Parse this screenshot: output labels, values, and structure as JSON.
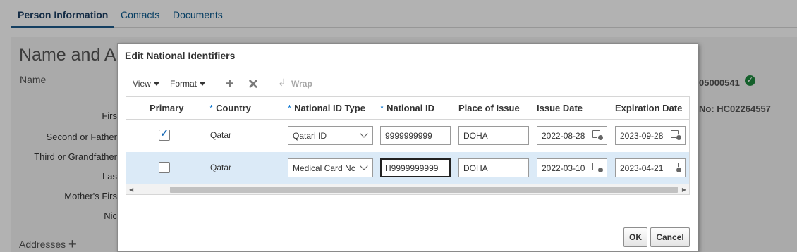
{
  "tabs": [
    {
      "label": "Person Information"
    },
    {
      "label": "Contacts"
    },
    {
      "label": "Documents"
    }
  ],
  "background": {
    "section_title": "Name and A",
    "name_label": "Name",
    "field_labels": [
      "Firs",
      "Second or Father",
      "Third or Grandfather",
      "Las",
      "Mother's Firs",
      "Nic"
    ],
    "addresses_label": "Addresses",
    "right_id_1": "05000541",
    "right_id_2": "No: HC02264557"
  },
  "dialog": {
    "title": "Edit National Identifiers",
    "toolbar": {
      "view_label": "View",
      "format_label": "Format",
      "wrap_label": "Wrap"
    },
    "columns": [
      {
        "label": "Primary",
        "required": false
      },
      {
        "label": "Country",
        "required": true
      },
      {
        "label": "National ID Type",
        "required": true
      },
      {
        "label": "National ID",
        "required": true
      },
      {
        "label": "Place of Issue",
        "required": false
      },
      {
        "label": "Issue Date",
        "required": false
      },
      {
        "label": "Expiration Date",
        "required": false
      }
    ],
    "required_mark": "*",
    "rows": [
      {
        "primary": true,
        "country": "Qatar",
        "id_type": "Qatari ID",
        "national_id": "9999999999",
        "place": "DOHA",
        "issue_date": "2022-08-28",
        "expiration_date": "2023-09-28"
      },
      {
        "primary": false,
        "country": "Qatar",
        "id_type": "Medical Card Nc",
        "national_id_prefix": "H",
        "national_id_suffix": "9999999999",
        "place": "DOHA",
        "issue_date": "2022-03-10",
        "expiration_date": "2023-04-21"
      }
    ],
    "ok_label": "OK",
    "cancel_label": "Cancel"
  }
}
